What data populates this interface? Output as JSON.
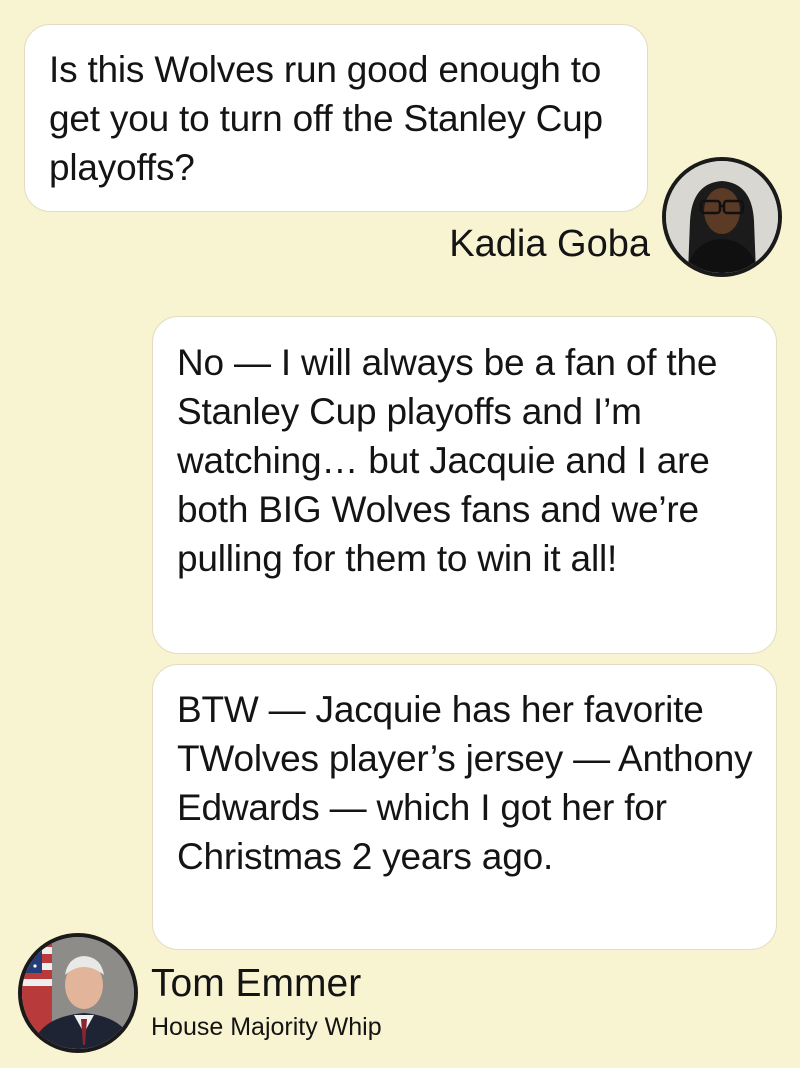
{
  "messages": [
    {
      "sender": "Kadia Goba",
      "text": "Is this Wolves run good enough to get you to turn off the Stanley Cup playoffs?"
    },
    {
      "sender": "Tom Emmer",
      "text": "No — I will always be a fan of the Stanley Cup playoffs and I’m watching… but Jacquie and I are both BIG Wolves fans and we’re pulling for them to win it all!"
    },
    {
      "sender": "Tom Emmer",
      "text": "BTW — Jacquie has her favorite TWolves player’s jersey — Anthony Edwards — which I got her for Christmas 2 years ago."
    }
  ],
  "participants": {
    "interviewer": {
      "name": "Kadia Goba",
      "avatar_icon": "portrait-photo"
    },
    "respondent": {
      "name": "Tom Emmer",
      "title": "House Majority Whip",
      "avatar_icon": "portrait-photo"
    }
  },
  "colors": {
    "background": "#f8f3d0",
    "bubble": "#ffffff",
    "bubble_border": "#e2dcc0",
    "text": "#141414",
    "avatar_ring": "#1a1a1a"
  }
}
